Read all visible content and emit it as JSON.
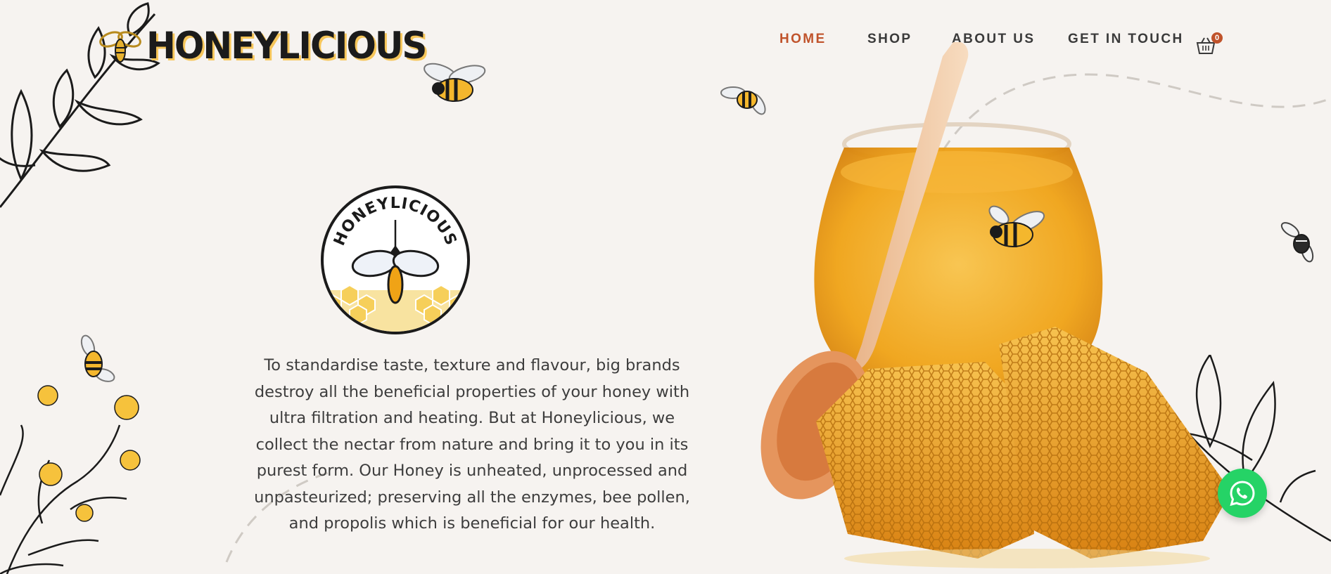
{
  "brand": {
    "name": "HONEYLICIOUS",
    "badge_text": "HONEYLICIOUS"
  },
  "nav": {
    "items": [
      {
        "label": "HOME",
        "active": true
      },
      {
        "label": "SHOP",
        "active": false
      },
      {
        "label": "ABOUT US",
        "active": false
      },
      {
        "label": "GET IN TOUCH",
        "active": false
      }
    ],
    "cart_count": "0"
  },
  "hero": {
    "intro_text": "To standardise taste, texture and flavour, big brands destroy all the beneficial properties of your honey with ultra filtration and heating. But at Honeylicious, we collect the nectar from nature and bring it to you in its purest form. Our Honey is unheated, unprocessed and unpasteurized; preserving all the enzymes, bee pollen, and propolis which is beneficial for our health.",
    "image_icon": "honey-jar-illustration"
  },
  "icons": {
    "cart": "basket-icon",
    "whatsapp": "whatsapp-icon",
    "bee": "bee-icon"
  },
  "colors": {
    "background": "#f6f3f0",
    "accent": "#c0532b",
    "honey": "#f2a21b",
    "whatsapp": "#25d366",
    "text": "#3d3d3d"
  }
}
